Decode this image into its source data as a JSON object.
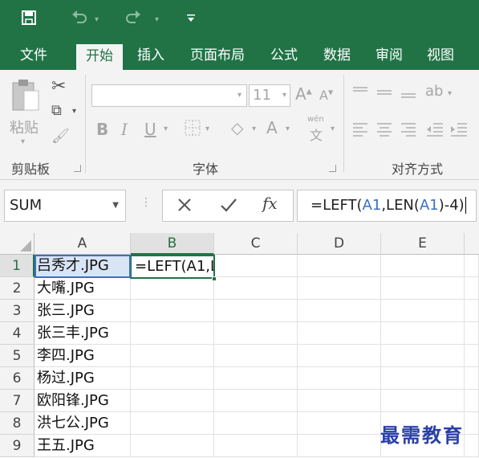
{
  "qat": {
    "save_icon": "save-icon",
    "undo_icon": "undo-icon",
    "redo_icon": "redo-icon",
    "customize_icon": "customize-qat-icon"
  },
  "tabs": [
    {
      "label": "文件"
    },
    {
      "label": "开始"
    },
    {
      "label": "插入"
    },
    {
      "label": "页面布局"
    },
    {
      "label": "公式"
    },
    {
      "label": "数据"
    },
    {
      "label": "审阅"
    },
    {
      "label": "视图"
    }
  ],
  "ribbon": {
    "clipboard": {
      "label": "剪贴板",
      "paste_label": "粘贴"
    },
    "font": {
      "label": "字体",
      "size": "11",
      "bold": "B",
      "italic": "I",
      "underline": "U",
      "font_color": "A",
      "wen": "wén",
      "wen_char": "文"
    },
    "alignment": {
      "label": "对齐方式"
    }
  },
  "formula_bar": {
    "name_box": "SUM",
    "fx": "fx",
    "formula_parts": [
      "=LEFT(",
      "A1",
      ",LEN(",
      "A1",
      ")-4)"
    ]
  },
  "grid": {
    "columns": [
      "A",
      "B",
      "C",
      "D",
      "E"
    ],
    "rows": [
      "1",
      "2",
      "3",
      "4",
      "5",
      "6",
      "7",
      "8",
      "9"
    ],
    "col_a": [
      "吕秀才.JPG",
      "大嘴.JPG",
      "张三.JPG",
      "张三丰.JPG",
      "李四.JPG",
      "杨过.JPG",
      "欧阳锋.JPG",
      "洪七公.JPG",
      "王五.JPG"
    ],
    "b1_editing": "=LEFT(A1,L"
  },
  "watermark": "最需教育",
  "colors": {
    "excel_green": "#217346",
    "ref_blue": "#3a6fc4"
  }
}
